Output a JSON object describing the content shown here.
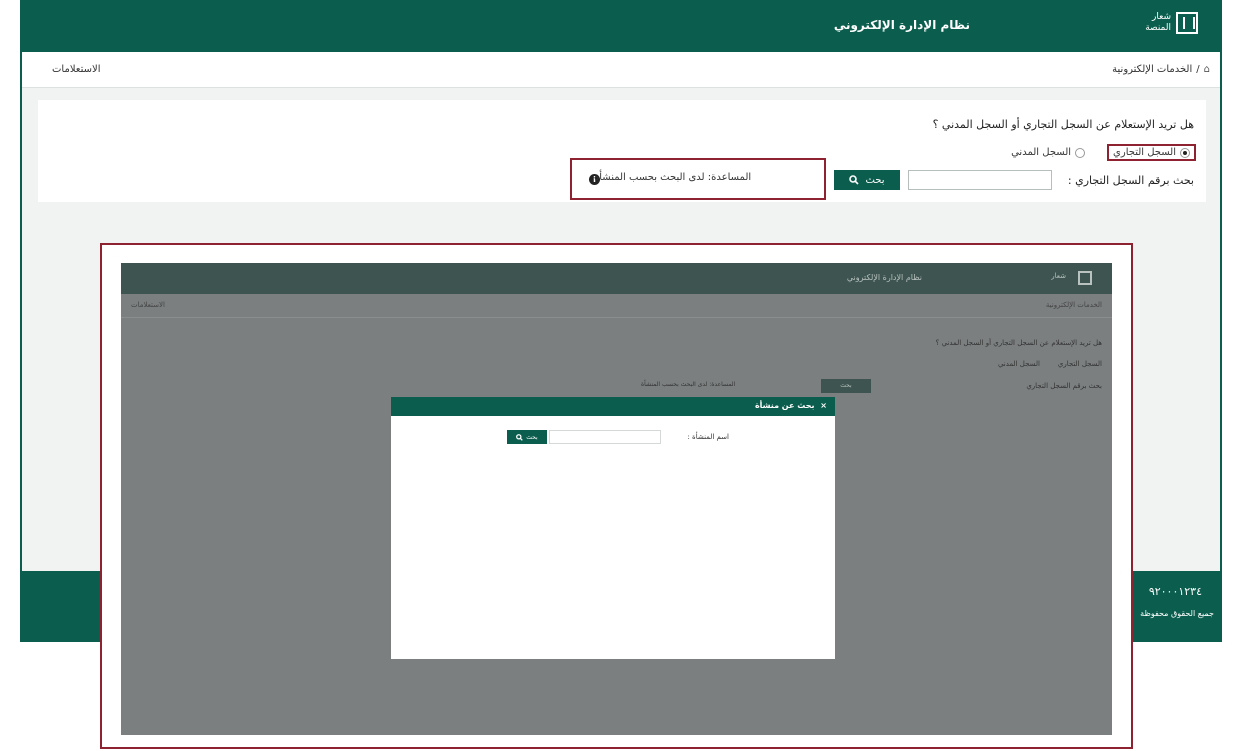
{
  "header": {
    "title": "نظام الإدارة الإلكتروني",
    "logo_text_line1": "شعار",
    "logo_text_line2": "المنصة"
  },
  "breadcrumb": {
    "items": [
      "الخدمات الإلكترونية"
    ],
    "right_link": "الاستعلامات"
  },
  "form": {
    "question": "هل تريد الإستعلام عن السجل التجاري أو السجل المدني ؟",
    "radio_options": [
      {
        "label": "السجل التجاري",
        "checked": true
      },
      {
        "label": "السجل المدني",
        "checked": false
      }
    ],
    "search_label": "بحث برقم السجل التجاري :",
    "search_value": "",
    "search_button": "بحث",
    "info_text": "المساعدة: لدى البحث بحسب المنشأة"
  },
  "footer": {
    "phone": "٩٢٠٠٠١٢٣٤",
    "note": "جميع الحقوق محفوظة"
  },
  "overlay": {
    "mini_title": "نظام الإدارة الإلكتروني",
    "mini_logo_text": "شعار",
    "mini_breadcrumb": "الخدمات الإلكترونية",
    "mini_link": "الاستعلامات",
    "mini_question": "هل تريد الإستعلام عن السجل التجاري أو السجل المدني ؟",
    "mini_radio_1": "السجل التجاري",
    "mini_radio_2": "السجل المدني",
    "mini_search_label": "بحث برقم السجل التجاري",
    "mini_button": "بحث",
    "mini_note": "المساعدة: لدى البحث بحسب المنشأة",
    "modal": {
      "title": "بحث عن منشأة",
      "close": "×",
      "field_label": "اسم المنشأة :",
      "field_value": "",
      "button": "بحث"
    }
  },
  "colors": {
    "brand": "#0b5e4e",
    "highlight": "#8e2230",
    "overlay_gray": "#7b7f80"
  }
}
